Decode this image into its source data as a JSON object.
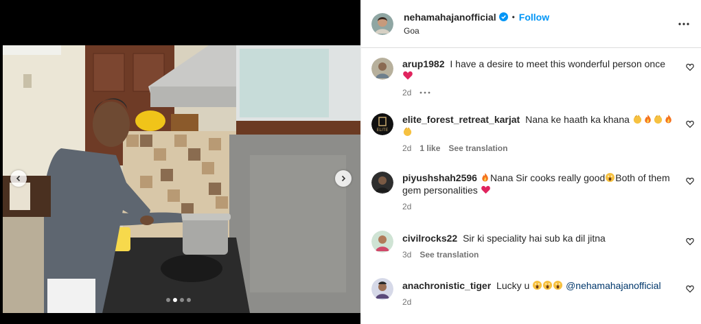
{
  "header": {
    "username": "nehamahajanofficial",
    "separator": "•",
    "follow_label": "Follow",
    "location": "Goa"
  },
  "carousel": {
    "slides": 4,
    "active_slide": 1
  },
  "comments": [
    {
      "user": "arup1982",
      "text": "I have a desire to meet this wonderful person once",
      "emoji_after": "red-heart",
      "time": "2d",
      "likes": "",
      "translate": ""
    },
    {
      "user": "elite_forest_retreat_karjat",
      "text": "Nana ke haath ka khana",
      "time": "2d",
      "likes": "1 like",
      "translate": "See translation"
    },
    {
      "user": "piyushshah2596",
      "text_a": "Nana Sir cooks really good",
      "text_b": "Both of them gem personalities",
      "time": "2d"
    },
    {
      "user": "civilrocks22",
      "text": "Sir ki speciality hai sub ka dil jitna",
      "time": "3d",
      "translate": "See translation"
    },
    {
      "user": "anachronistic_tiger",
      "text": "Lucky u",
      "mention": "@nehamahajanofficial",
      "time": "2d"
    }
  ],
  "colors": {
    "accent": "#0095f6",
    "muted": "#737373",
    "heart": "#e0245e"
  },
  "icons": [
    "chevron-left-icon",
    "chevron-right-icon",
    "verified-badge-icon",
    "more-options-icon",
    "heart-outline-icon",
    "red-heart-emoji",
    "clap-emoji",
    "fire-emoji",
    "scream-emoji"
  ]
}
